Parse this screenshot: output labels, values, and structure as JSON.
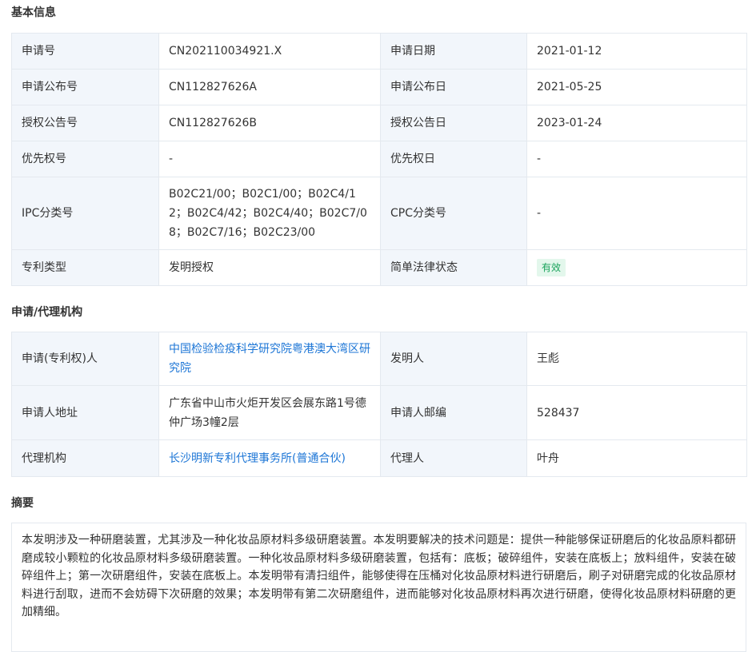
{
  "basic": {
    "title": "基本信息",
    "rows": [
      {
        "l1": "申请号",
        "v1": "CN202110034921.X",
        "l2": "申请日期",
        "v2": "2021-01-12"
      },
      {
        "l1": "申请公布号",
        "v1": "CN112827626A",
        "l2": "申请公布日",
        "v2": "2021-05-25"
      },
      {
        "l1": "授权公告号",
        "v1": "CN112827626B",
        "l2": "授权公告日",
        "v2": "2023-01-24"
      },
      {
        "l1": "优先权号",
        "v1": "-",
        "l2": "优先权日",
        "v2": "-"
      },
      {
        "l1": "IPC分类号",
        "v1": "B02C21/00；B02C1/00；B02C4/12；B02C4/42；B02C4/40；B02C7/08；B02C7/16；B02C23/00",
        "l2": "CPC分类号",
        "v2": "-"
      },
      {
        "l1": "专利类型",
        "v1": "发明授权",
        "l2": "简单法律状态",
        "v2": "有效"
      }
    ]
  },
  "agency": {
    "title": "申请/代理机构",
    "rows": [
      {
        "l1": "申请(专利权)人",
        "v1": "中国检验检疫科学研究院粤港澳大湾区研究院",
        "l2": "发明人",
        "v2": "王彪"
      },
      {
        "l1": "申请人地址",
        "v1": "广东省中山市火炬开发区会展东路1号德仲广场3幢2层",
        "l2": "申请人邮编",
        "v2": "528437"
      },
      {
        "l1": "代理机构",
        "v1": "长沙明新专利代理事务所(普通合伙)",
        "l2": "代理人",
        "v2": "叶舟"
      }
    ]
  },
  "abstract": {
    "title": "摘要",
    "text": "本发明涉及一种研磨装置，尤其涉及一种化妆品原材料多级研磨装置。本发明要解决的技术问题是：提供一种能够保证研磨后的化妆品原料都研磨成较小颗粒的化妆品原材料多级研磨装置。一种化妆品原材料多级研磨装置，包括有：底板；破碎组件，安装在底板上；放料组件，安装在破碎组件上；第一次研磨组件，安装在底板上。本发明带有清扫组件，能够使得在压桶对化妆品原材料进行研磨后，刷子对研磨完成的化妆品原材料进行刮取，进而不会妨碍下次研磨的效果；本发明带有第二次研磨组件，进而能够对化妆品原材料再次进行研磨，使得化妆品原材料研磨的更加精细。"
  },
  "colors": {
    "label_bg": "#f2f6fb",
    "border": "#e4e9ef",
    "link": "#1d76d6",
    "status_bg": "#e3f7ec",
    "status_text": "#1aa35c"
  }
}
